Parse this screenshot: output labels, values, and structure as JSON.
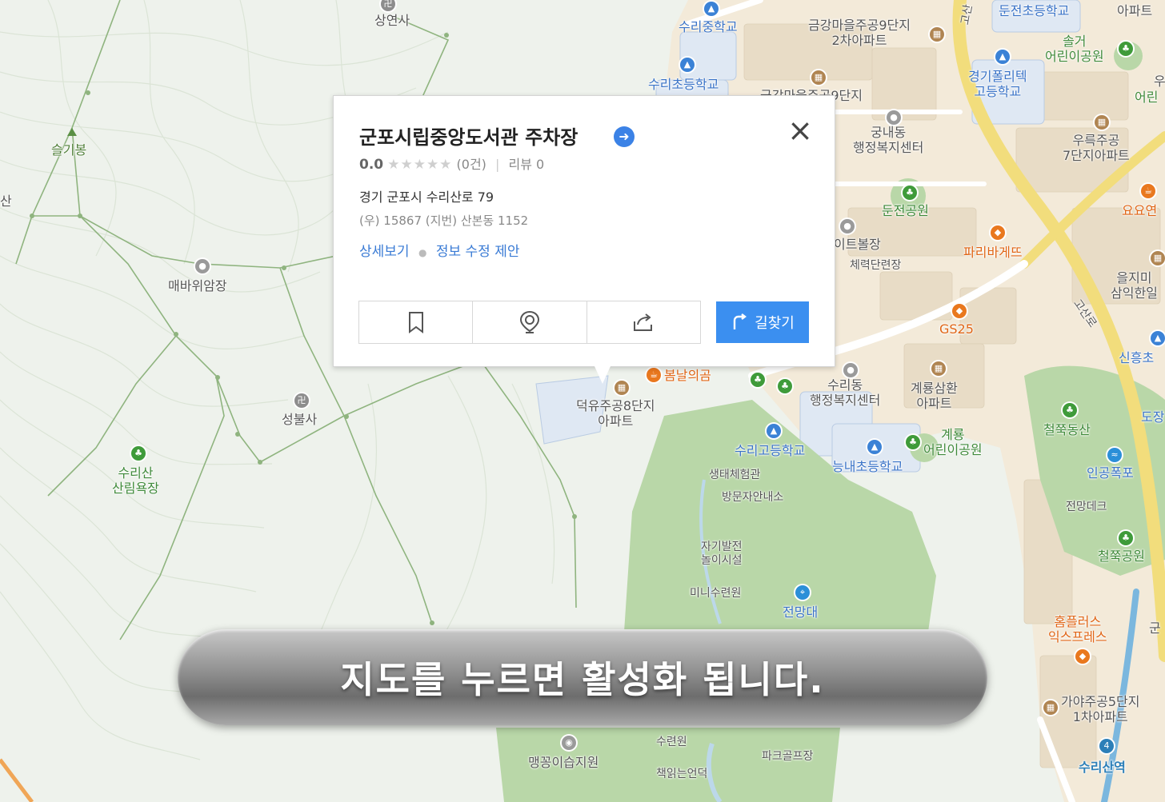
{
  "infowindow": {
    "title": "군포시립중앙도서관 주차장",
    "rating": "0.0",
    "stars": "★★★★★",
    "count": "(0건)",
    "review": "리뷰 0",
    "address": "경기 군포시 수리산로 79",
    "postal_line": "(우) 15867   (지번) 산본동 1152",
    "detail_link": "상세보기",
    "edit_link": "정보 수정 제안",
    "route_label": "길찾기",
    "close_symbol": "×",
    "dir_symbol": "➜"
  },
  "banner": {
    "text": "지도를 누르면 활성화 됩니다."
  },
  "map": {
    "labels": {
      "sangyeonsa": "상연사",
      "seulgibong": "슬기봉",
      "san": "산",
      "maebawi": "매바위암장",
      "seongbulsa": "성불사",
      "surisan_forest": "수리산\n산림욕장",
      "suri_middle": "수리중학교",
      "suri_elem": "수리초등학교",
      "geumgang9_2": "금강마을주공9단지\n2차아파트",
      "geumgang9": "금강마을주공9단지",
      "gungnae": "궁내동\n행정복지센터",
      "dunjeon_elem": "둔전초등학교",
      "apart_top": "아파트",
      "solgeo": "솔거\n어린이공원",
      "gyeonggi_poly": "경기폴리텍\n고등학교",
      "u_label": "우",
      "eorin_right": "어린",
      "woorook7": "우륵주공\n7단지아파트",
      "yoyo": "요요연",
      "dunjeon_park": "둔전공원",
      "itebol": "이트볼장",
      "fitness": "체력단련장",
      "paris": "파리바게뜨",
      "euljimi": "을지미\n삼익한일",
      "gosanro": "고산로",
      "gosanro2": "고산",
      "gs25": "GS25",
      "sinheung": "신흥초",
      "bomnal": "봄날의곰",
      "deokyu8": "덕유주공8단지\n아파트",
      "suri_dong": "수리동\n행정복지센터",
      "gyeryong_apt": "계룡삼환\n아파트",
      "cheoljjuk_san": "철쭉동산",
      "dojang": "도장",
      "suri_high": "수리고등학교",
      "gyeryong_park": "계룡\n어린이공원",
      "neungnae": "능내초등학교",
      "artificial_fall": "인공폭포",
      "ecology": "생태체험관",
      "visitor": "방문자안내소",
      "jeonmang_deck": "전망데크",
      "cheoljjuk_park": "철쭉공원",
      "self_dev": "자기발전\n놀이시설",
      "mini_suryeon": "미니수련원",
      "observatory": "전망대",
      "homeplus": "홈플러스\n익스프레스",
      "gun": "군",
      "gaya5": "가야주공5단지\n1차아파트",
      "maengkkongi": "맹꽁이습지원",
      "suryeonwon": "수련원",
      "paekigol": "파크골프장",
      "chaegingneun": "책읽는언덕",
      "surisan_stn": "수리산역",
      "station_no": "4"
    }
  }
}
